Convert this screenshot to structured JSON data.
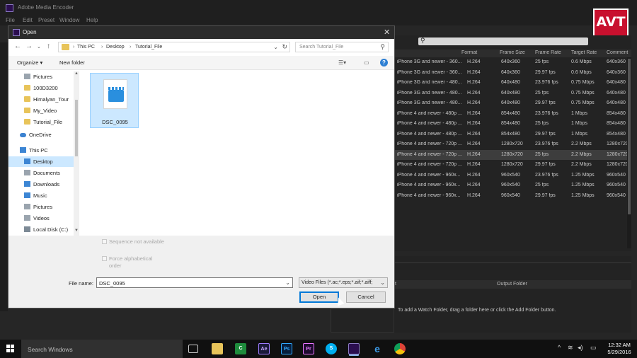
{
  "app": {
    "title": "Adobe Media Encoder",
    "menu": [
      "File",
      "Edit",
      "Preset",
      "Window",
      "Help"
    ],
    "watermark": "AVT"
  },
  "preset_table": {
    "columns": [
      "Format",
      "Frame Size",
      "Frame Rate",
      "Target Rate",
      "Comment"
    ],
    "rows": [
      {
        "name": "iPhone 3G and newer - 360...",
        "format": "H.264",
        "frame_size": "640x360",
        "frame_rate": "25 fps",
        "target_rate": "0.6 Mbps",
        "comment": "640x360"
      },
      {
        "name": "iPhone 3G and newer - 360...",
        "format": "H.264",
        "frame_size": "640x360",
        "frame_rate": "29.97 fps",
        "target_rate": "0.6 Mbps",
        "comment": "640x360"
      },
      {
        "name": "iPhone 3G and newer - 480...",
        "format": "H.264",
        "frame_size": "640x480",
        "frame_rate": "23.976 fps",
        "target_rate": "0.75 Mbps",
        "comment": "640x480"
      },
      {
        "name": "iPhone 3G and newer - 480...",
        "format": "H.264",
        "frame_size": "640x480",
        "frame_rate": "25 fps",
        "target_rate": "0.75 Mbps",
        "comment": "640x480"
      },
      {
        "name": "iPhone 3G and newer - 480...",
        "format": "H.264",
        "frame_size": "640x480",
        "frame_rate": "29.97 fps",
        "target_rate": "0.75 Mbps",
        "comment": "640x480"
      },
      {
        "name": "iPhone 4 and newer - 480p ...",
        "format": "H.264",
        "frame_size": "854x480",
        "frame_rate": "23.976 fps",
        "target_rate": "1 Mbps",
        "comment": "854x480"
      },
      {
        "name": "iPhone 4 and newer - 480p ...",
        "format": "H.264",
        "frame_size": "854x480",
        "frame_rate": "25 fps",
        "target_rate": "1 Mbps",
        "comment": "854x480"
      },
      {
        "name": "iPhone 4 and newer - 480p ...",
        "format": "H.264",
        "frame_size": "854x480",
        "frame_rate": "29.97 fps",
        "target_rate": "1 Mbps",
        "comment": "854x480"
      },
      {
        "name": "iPhone 4 and newer - 720p ...",
        "format": "H.264",
        "frame_size": "1280x720",
        "frame_rate": "23.976 fps",
        "target_rate": "2.2 Mbps",
        "comment": "1280x720"
      },
      {
        "name": "iPhone 4 and newer - 720p ...",
        "format": "H.264",
        "frame_size": "1280x720",
        "frame_rate": "25 fps",
        "target_rate": "2.2 Mbps",
        "comment": "1280x720"
      },
      {
        "name": "iPhone 4 and newer - 720p ...",
        "format": "H.264",
        "frame_size": "1280x720",
        "frame_rate": "29.97 fps",
        "target_rate": "2.2 Mbps",
        "comment": "1280x720"
      },
      {
        "name": "iPhone 4 and newer - 960x...",
        "format": "H.264",
        "frame_size": "960x540",
        "frame_rate": "23.976 fps",
        "target_rate": "1.25 Mbps",
        "comment": "960x540"
      },
      {
        "name": "iPhone 4 and newer - 960x...",
        "format": "H.264",
        "frame_size": "960x540",
        "frame_rate": "25 fps",
        "target_rate": "1.25 Mbps",
        "comment": "960x540"
      },
      {
        "name": "iPhone 4 and newer - 960x...",
        "format": "H.264",
        "frame_size": "960x540",
        "frame_rate": "29.97 fps",
        "target_rate": "1.25 Mbps",
        "comment": "960x540"
      }
    ]
  },
  "watch_folders": {
    "column_left": "t",
    "column_right": "Output Folder",
    "message": "To add a Watch Folder, drag a folder here or click the Add Folder button."
  },
  "dialog": {
    "title": "Open",
    "breadcrumb": [
      "This PC",
      "Desktop",
      "Tutorial_File"
    ],
    "search_placeholder": "Search Tutorial_File",
    "organize_label": "Organize ▾",
    "new_folder_label": "New folder",
    "nav_items": [
      {
        "label": "Pictures",
        "icon": "pictures-icon"
      },
      {
        "label": "100D3200",
        "icon": "folder-icon"
      },
      {
        "label": "Himalyan_Tour",
        "icon": "folder-icon"
      },
      {
        "label": "My_Video",
        "icon": "folder-icon"
      },
      {
        "label": "Tutorial_File",
        "icon": "folder-icon"
      },
      {
        "label": "OneDrive",
        "icon": "cloud-icon"
      },
      {
        "label": "This PC",
        "icon": "computer-icon"
      },
      {
        "label": "Desktop",
        "icon": "desktop-icon",
        "selected": true
      },
      {
        "label": "Documents",
        "icon": "documents-icon"
      },
      {
        "label": "Downloads",
        "icon": "downloads-icon"
      },
      {
        "label": "Music",
        "icon": "music-icon"
      },
      {
        "label": "Pictures",
        "icon": "pictures-icon"
      },
      {
        "label": "Videos",
        "icon": "videos-icon"
      },
      {
        "label": "Local Disk (C:)",
        "icon": "drive-icon"
      }
    ],
    "file": {
      "name": "DSC_0095",
      "icon": "video-file-icon"
    },
    "options": {
      "sequence": "Sequence not available",
      "alphabetical": "Force alphabetical order"
    },
    "filename_label": "File name:",
    "filename_value": "DSC_0095",
    "filetype_value": "Video Files (*.ac;*.eps;*.aif;*.aiff;",
    "open_label": "Open",
    "cancel_label": "Cancel"
  },
  "taskbar": {
    "search_placeholder": "Search Windows",
    "apps": [
      {
        "name": "task-view",
        "label": ""
      },
      {
        "name": "file-explorer",
        "label": ""
      },
      {
        "name": "camtasia",
        "label": "C"
      },
      {
        "name": "after-effects",
        "label": "Ae"
      },
      {
        "name": "photoshop",
        "label": "Ps"
      },
      {
        "name": "premiere",
        "label": "Pr"
      },
      {
        "name": "skype",
        "label": "S"
      },
      {
        "name": "media-encoder",
        "label": ""
      },
      {
        "name": "edge",
        "label": "e"
      },
      {
        "name": "chrome",
        "label": ""
      }
    ],
    "time": "12:32 AM",
    "date": "5/29/2016"
  }
}
